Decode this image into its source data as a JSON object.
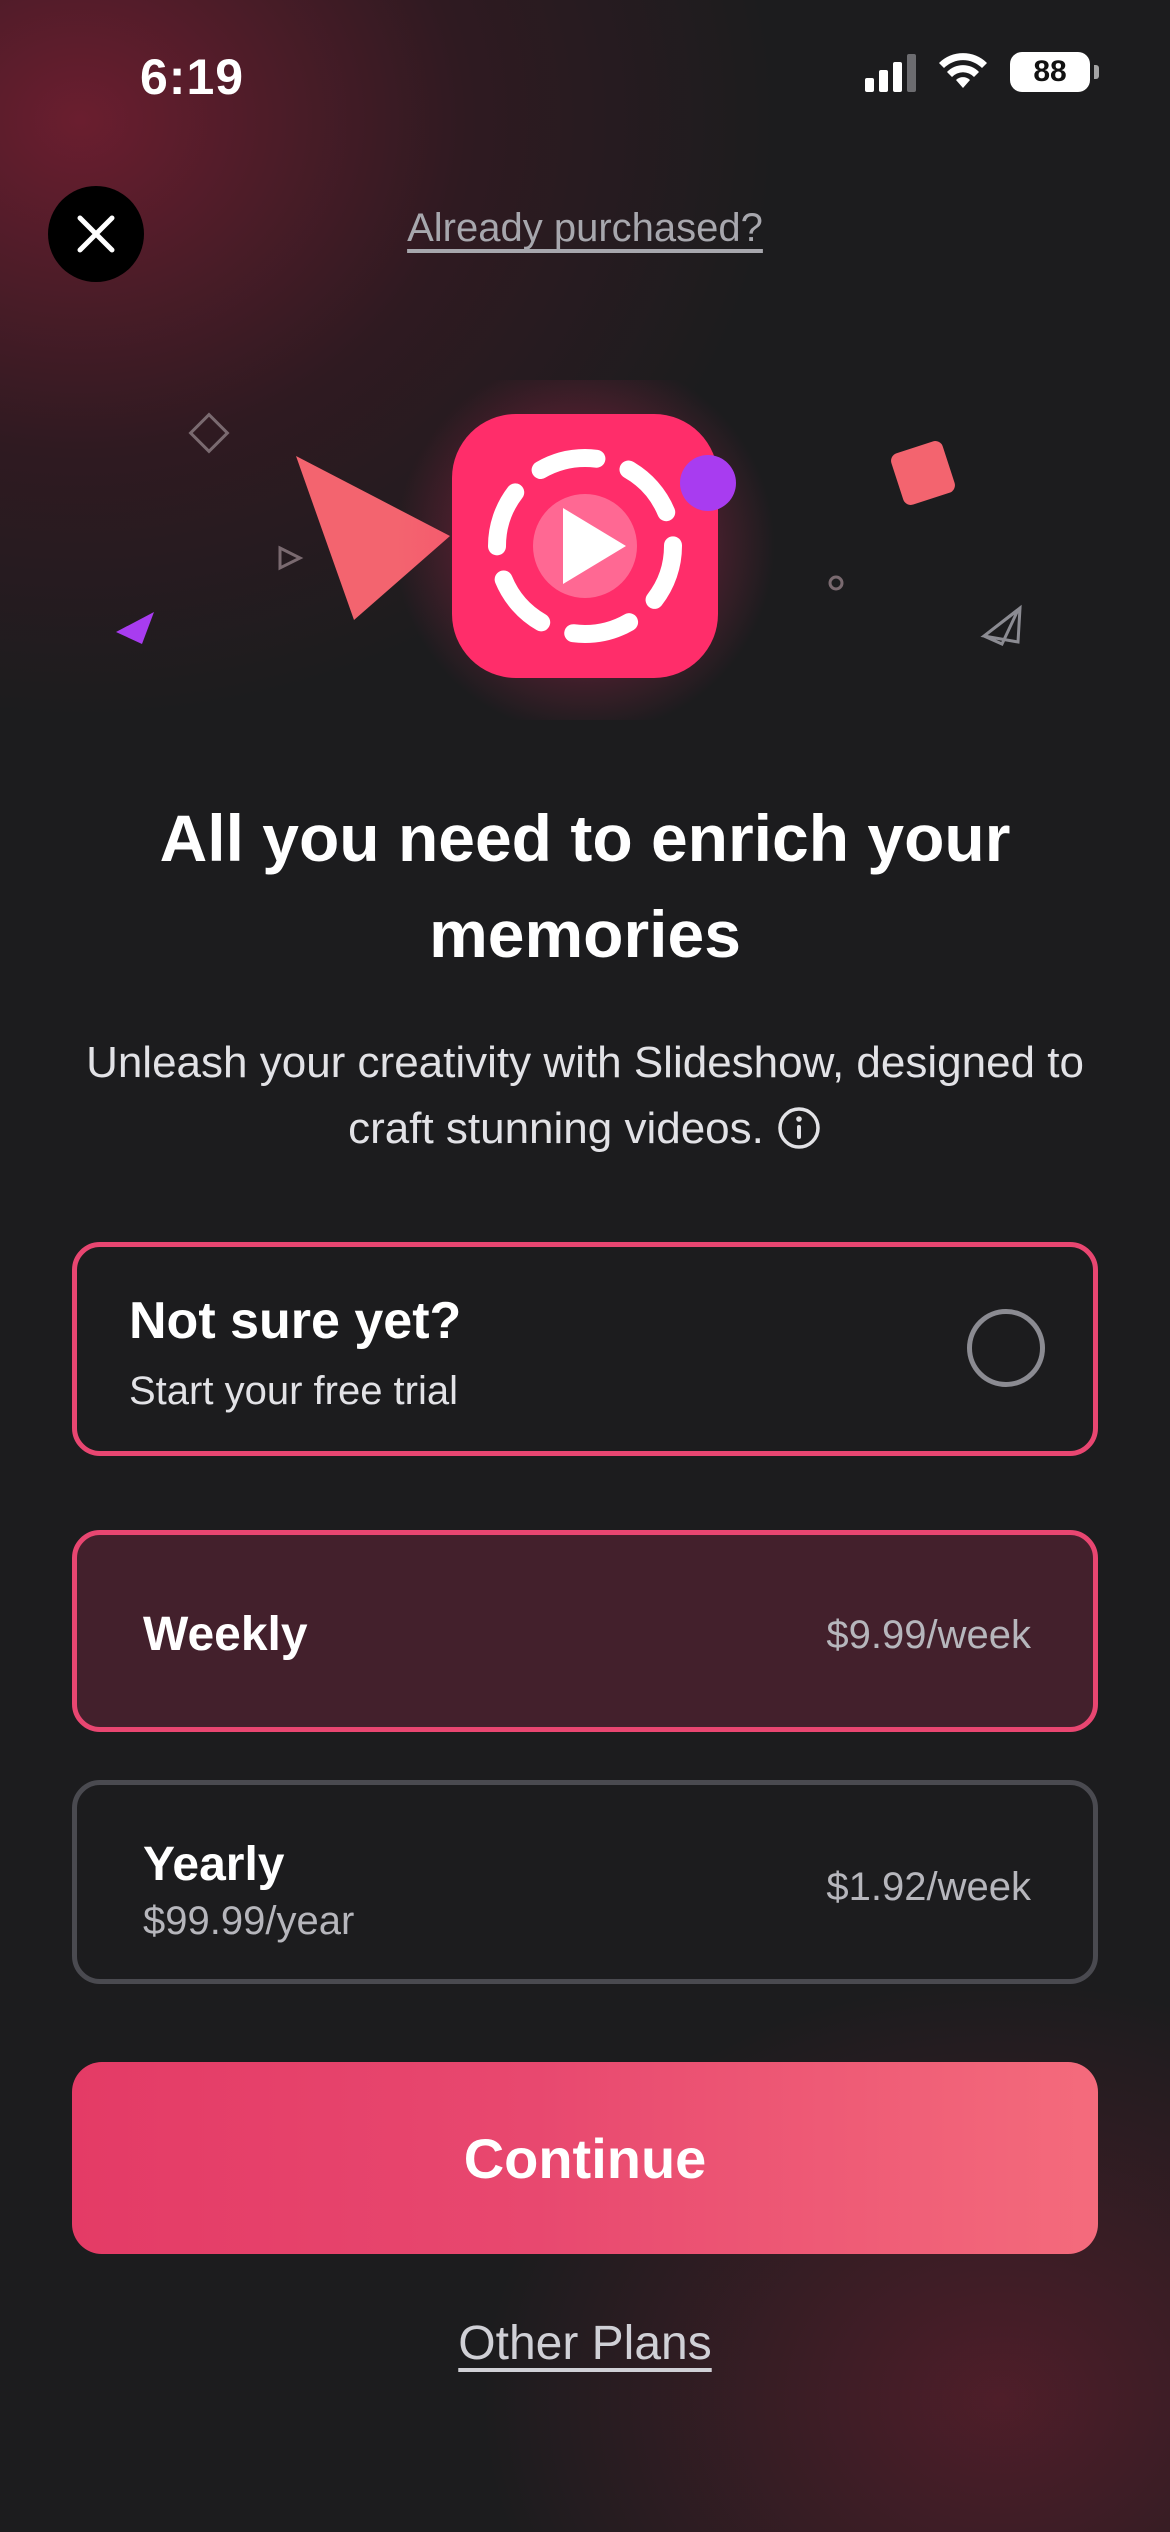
{
  "status_bar": {
    "time": "6:19",
    "battery_level": "88",
    "icons": [
      "cellular-signal-icon",
      "wifi-icon",
      "battery-icon"
    ]
  },
  "header": {
    "close_icon": "close-icon",
    "already_purchased_label": "Already purchased?"
  },
  "hero": {
    "app_icon": "slideshow-play-icon",
    "accent_color": "#ff2d6a",
    "decorations": [
      "diamond-outline",
      "triangle-outline",
      "triangle-filled-purple",
      "triangle-filled-coral",
      "square-coral",
      "circle-outline",
      "triangle-outline"
    ]
  },
  "headline": "All you need to enrich your memories",
  "subtext": "Unleash your creativity with Slideshow, designed to craft stunning videos.",
  "trial_option": {
    "title": "Not sure yet?",
    "subtitle": "Start your free trial",
    "selected": false
  },
  "plans": [
    {
      "name": "Weekly",
      "price": "$9.99/week",
      "selected": true
    },
    {
      "name": "Yearly",
      "detail": "$99.99/year",
      "price": "$1.92/week",
      "selected": false
    }
  ],
  "continue_label": "Continue",
  "other_plans_label": "Other Plans",
  "colors": {
    "background": "#1c1c1e",
    "accent": "#e84671",
    "selected_card_bg": "#43202c",
    "button_gradient_start": "#e43b66",
    "button_gradient_end": "#f46b7c"
  }
}
